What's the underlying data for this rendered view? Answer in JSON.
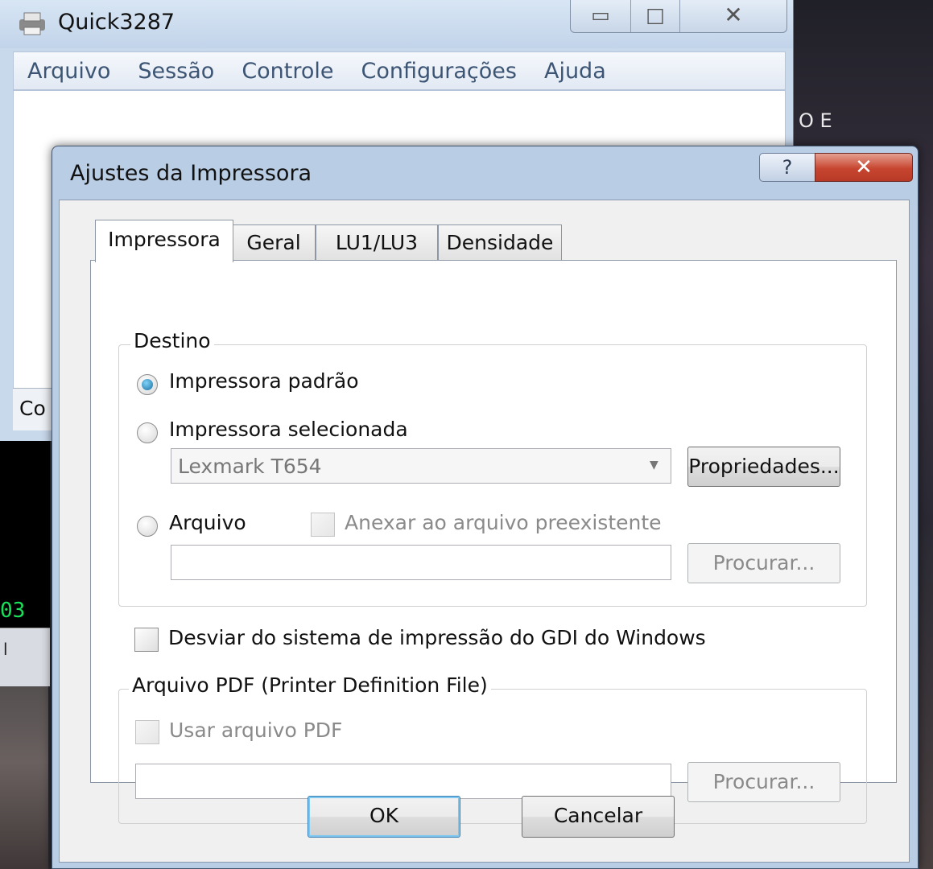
{
  "background": {
    "desktop_text": "O E",
    "terminal_text": "03",
    "terminal_bar_text": "l"
  },
  "main_window": {
    "title": "Quick3287",
    "icon": "printer-app-icon",
    "caption": {
      "minimize": "▭",
      "maximize": "□",
      "close": "✕"
    },
    "menu": [
      "Arquivo",
      "Sessão",
      "Controle",
      "Configurações",
      "Ajuda"
    ],
    "status_text": "Co"
  },
  "dialog": {
    "title": "Ajustes da Impressora",
    "help_label": "?",
    "close_label": "✕",
    "tabs": [
      "Impressora",
      "Geral",
      "LU1/LU3",
      "Densidade"
    ],
    "active_tab": "Impressora",
    "destino": {
      "legend": "Destino",
      "radio_default": "Impressora padrão",
      "radio_selected": "Impressora selecionada",
      "printer_value": "Lexmark T654",
      "properties_button": "Propriedades...",
      "radio_file": "Arquivo",
      "append_checkbox": "Anexar ao arquivo preexistente",
      "file_path": "",
      "browse_button": "Procurar..."
    },
    "bypass_gdi_checkbox": "Desviar do sistema de impressão do GDI do Windows",
    "pdf": {
      "legend": "Arquivo PDF (Printer Definition File)",
      "use_pdf_checkbox": "Usar arquivo PDF",
      "pdf_path": "",
      "browse_button": "Procurar..."
    },
    "ok_button": "OK",
    "cancel_button": "Cancelar"
  },
  "colors": {
    "window_frame": "#b9cde5",
    "close_button_red": "#c64530",
    "radio_selected_blue": "#1a6fa3"
  }
}
